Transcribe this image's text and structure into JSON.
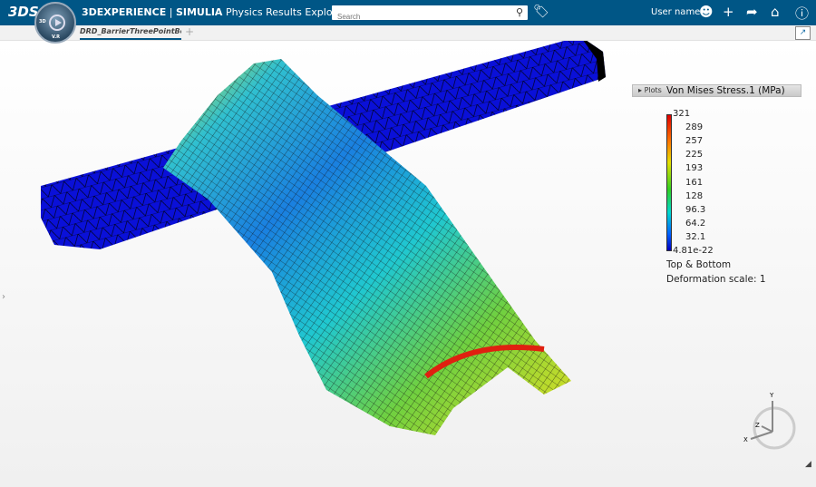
{
  "header": {
    "logo": "3DS",
    "app_brand": "3DEXPERIENCE",
    "app_sep": " | ",
    "app_product": "SIMULIA",
    "app_name": " Physics Results Explorer",
    "search_placeholder": "Search",
    "user_name": "User name"
  },
  "compass": {
    "top": "3D",
    "bottom": "V.R"
  },
  "tabs": [
    {
      "label": "DRD_BarrierThreePointBend",
      "active": true
    }
  ],
  "add_tab": "+",
  "plots_panel": {
    "label": "Plots"
  },
  "legend": {
    "title": "Von Mises Stress.1 (MPa)",
    "ticks": [
      "321",
      "289",
      "257",
      "225",
      "193",
      "161",
      "128",
      "96.3",
      "64.2",
      "32.1",
      "4.81e-22"
    ],
    "colors": [
      "#e00000",
      "#ff7a00",
      "#e5e000",
      "#30d020",
      "#00d8d0",
      "#0060ff",
      "#0000c0"
    ],
    "face": "Top & Bottom",
    "deformation": "Deformation scale: 1"
  },
  "axes": {
    "x": "X",
    "y": "Y",
    "z": "Z"
  }
}
